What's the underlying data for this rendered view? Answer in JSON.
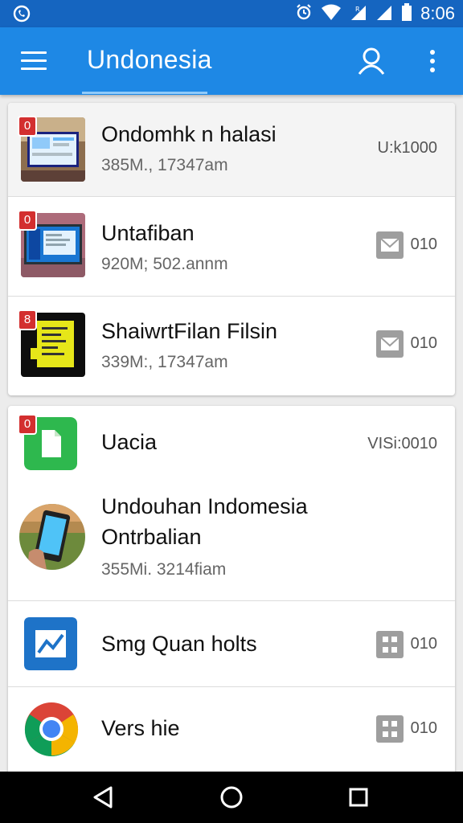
{
  "status_bar": {
    "time": "8:06",
    "icons": [
      "whatsapp-icon",
      "alarm-icon",
      "wifi-icon",
      "signal-icon",
      "signal-icon",
      "battery-icon"
    ]
  },
  "app_bar": {
    "title": "Undonesia",
    "icons": [
      "menu-icon",
      "account-icon",
      "more-vert-icon"
    ],
    "color": "#1e88e5"
  },
  "list_group_1": [
    {
      "badge": "0",
      "title": "Ondomhk n halasi",
      "subtitle": "385M., 17347am",
      "meta": "U:k1000",
      "thumb": "laptop-screen-thumbnail"
    },
    {
      "badge": "0",
      "title": "Untafiban",
      "subtitle": "920M; 502.annm",
      "meta": "010",
      "thumb": "monitor-thumbnail",
      "action_icon": "mail-icon"
    },
    {
      "badge": "8",
      "title": "ShaiwrtFilan Filsin",
      "subtitle": "339M:, 17347am",
      "meta": "010",
      "thumb": "yellow-document-thumbnail",
      "action_icon": "mail-icon"
    }
  ],
  "list_group_2": [
    {
      "badge": "0",
      "title": "Uacia",
      "meta": "VISi:0010",
      "thumb": "green-document-icon"
    },
    {
      "title_line1": "Undouhan Indomesia",
      "title_line2": "Ontrbalian",
      "subtitle": "355Mi. 3214fiam",
      "thumb": "smartphone-photo"
    },
    {
      "title": "Smg Quan holts",
      "meta": "010",
      "thumb": "blue-chart-icon",
      "action_icon": "grid-icon"
    },
    {
      "title": "Vers hie",
      "meta": "010",
      "thumb": "chrome-icon",
      "action_icon": "grid-icon"
    }
  ],
  "nav_bar": {
    "icons": [
      "back-icon",
      "home-icon",
      "recents-icon"
    ]
  },
  "colors": {
    "primary": "#1e88e5",
    "status_bar": "#1565c0",
    "badge": "#d32f2f"
  }
}
